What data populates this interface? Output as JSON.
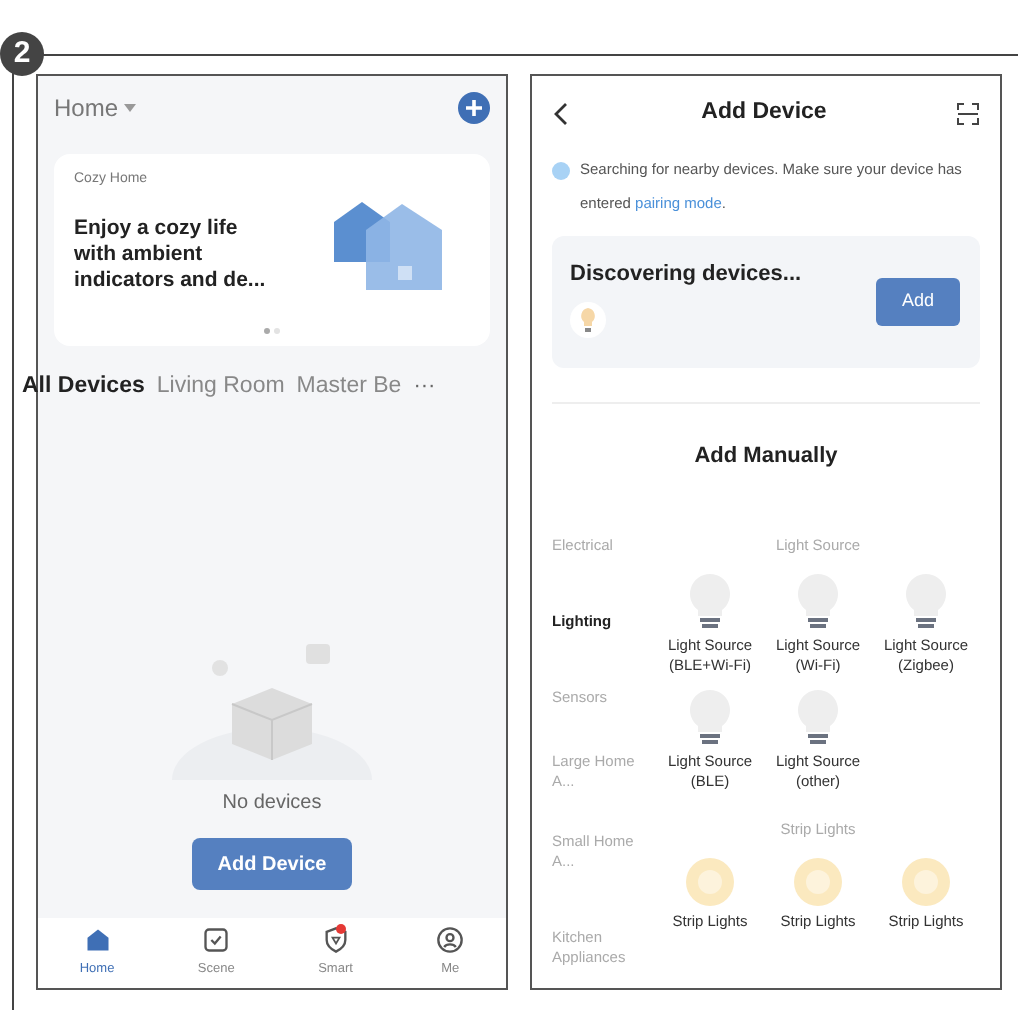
{
  "step_badge": "2",
  "home_screen": {
    "home_selector": "Home",
    "banner": {
      "caption": "Cozy Home",
      "headline": "Enjoy a cozy life with ambient indicators and de...",
      "pages": [
        {
          "selected": true
        },
        {
          "selected": false
        }
      ]
    },
    "room_tabs": [
      {
        "label": "All Devices",
        "selected": true
      },
      {
        "label": "Living Room",
        "selected": false
      },
      {
        "label": "Master Be",
        "selected": false
      }
    ],
    "more_tabs": "···",
    "empty_text": "No devices",
    "add_button": "Add Device",
    "nav": [
      {
        "kind": "home",
        "label": "Home",
        "selected": true,
        "badge": false
      },
      {
        "kind": "scene",
        "label": "Scene",
        "selected": false,
        "badge": false
      },
      {
        "kind": "smart",
        "label": "Smart",
        "selected": false,
        "badge": true
      },
      {
        "kind": "me",
        "label": "Me",
        "selected": false,
        "badge": false
      }
    ]
  },
  "add_device_screen": {
    "title": "Add Device",
    "notice": "Searching for nearby devices. Make sure your device has entered",
    "notice_link": "pairing mode",
    "notice_end": ".",
    "discovering": {
      "title": "Discovering devices...",
      "button": "Add"
    },
    "manual_title": "Add Manually",
    "categories": [
      {
        "label": "Electrical",
        "selected": false
      },
      {
        "label": "Lighting",
        "selected": true
      },
      {
        "label": "Sensors",
        "selected": false
      },
      {
        "label": "Large Home A...",
        "selected": false
      },
      {
        "label": "Small Home A...",
        "selected": false
      },
      {
        "label": "Kitchen Appliances",
        "selected": false
      }
    ],
    "groups": [
      {
        "title": "Light Source",
        "items": [
          {
            "kind": "bulb",
            "label": "Light Source (BLE+Wi-Fi)"
          },
          {
            "kind": "bulb",
            "label": "Light Source (Wi-Fi)"
          },
          {
            "kind": "bulb",
            "label": "Light Source (Zigbee)"
          },
          {
            "kind": "bulb",
            "label": "Light Source (BLE)"
          },
          {
            "kind": "bulb",
            "label": "Light Source (other)"
          }
        ]
      },
      {
        "title": "Strip Lights",
        "items": [
          {
            "kind": "strip",
            "label": "Strip Lights"
          },
          {
            "kind": "strip",
            "label": "Strip Lights"
          },
          {
            "kind": "strip",
            "label": "Strip Lights"
          }
        ]
      }
    ]
  }
}
